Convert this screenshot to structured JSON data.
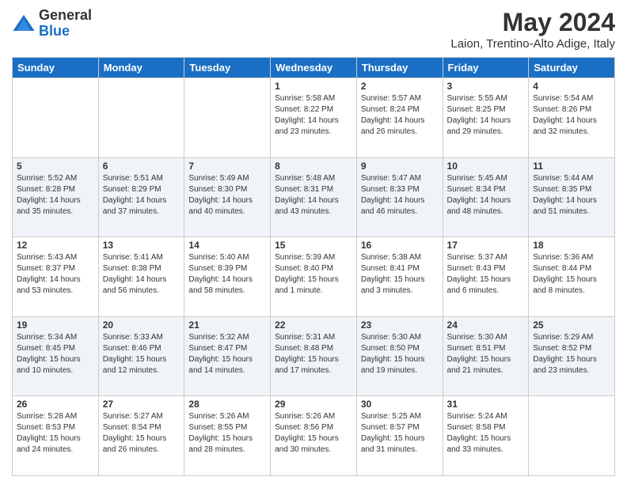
{
  "logo": {
    "general": "General",
    "blue": "Blue"
  },
  "title": "May 2024",
  "subtitle": "Laion, Trentino-Alto Adige, Italy",
  "days_of_week": [
    "Sunday",
    "Monday",
    "Tuesday",
    "Wednesday",
    "Thursday",
    "Friday",
    "Saturday"
  ],
  "weeks": [
    [
      {
        "day": "",
        "info": ""
      },
      {
        "day": "",
        "info": ""
      },
      {
        "day": "",
        "info": ""
      },
      {
        "day": "1",
        "info": "Sunrise: 5:58 AM\nSunset: 8:22 PM\nDaylight: 14 hours\nand 23 minutes."
      },
      {
        "day": "2",
        "info": "Sunrise: 5:57 AM\nSunset: 8:24 PM\nDaylight: 14 hours\nand 26 minutes."
      },
      {
        "day": "3",
        "info": "Sunrise: 5:55 AM\nSunset: 8:25 PM\nDaylight: 14 hours\nand 29 minutes."
      },
      {
        "day": "4",
        "info": "Sunrise: 5:54 AM\nSunset: 8:26 PM\nDaylight: 14 hours\nand 32 minutes."
      }
    ],
    [
      {
        "day": "5",
        "info": "Sunrise: 5:52 AM\nSunset: 8:28 PM\nDaylight: 14 hours\nand 35 minutes."
      },
      {
        "day": "6",
        "info": "Sunrise: 5:51 AM\nSunset: 8:29 PM\nDaylight: 14 hours\nand 37 minutes."
      },
      {
        "day": "7",
        "info": "Sunrise: 5:49 AM\nSunset: 8:30 PM\nDaylight: 14 hours\nand 40 minutes."
      },
      {
        "day": "8",
        "info": "Sunrise: 5:48 AM\nSunset: 8:31 PM\nDaylight: 14 hours\nand 43 minutes."
      },
      {
        "day": "9",
        "info": "Sunrise: 5:47 AM\nSunset: 8:33 PM\nDaylight: 14 hours\nand 46 minutes."
      },
      {
        "day": "10",
        "info": "Sunrise: 5:45 AM\nSunset: 8:34 PM\nDaylight: 14 hours\nand 48 minutes."
      },
      {
        "day": "11",
        "info": "Sunrise: 5:44 AM\nSunset: 8:35 PM\nDaylight: 14 hours\nand 51 minutes."
      }
    ],
    [
      {
        "day": "12",
        "info": "Sunrise: 5:43 AM\nSunset: 8:37 PM\nDaylight: 14 hours\nand 53 minutes."
      },
      {
        "day": "13",
        "info": "Sunrise: 5:41 AM\nSunset: 8:38 PM\nDaylight: 14 hours\nand 56 minutes."
      },
      {
        "day": "14",
        "info": "Sunrise: 5:40 AM\nSunset: 8:39 PM\nDaylight: 14 hours\nand 58 minutes."
      },
      {
        "day": "15",
        "info": "Sunrise: 5:39 AM\nSunset: 8:40 PM\nDaylight: 15 hours\nand 1 minute."
      },
      {
        "day": "16",
        "info": "Sunrise: 5:38 AM\nSunset: 8:41 PM\nDaylight: 15 hours\nand 3 minutes."
      },
      {
        "day": "17",
        "info": "Sunrise: 5:37 AM\nSunset: 8:43 PM\nDaylight: 15 hours\nand 6 minutes."
      },
      {
        "day": "18",
        "info": "Sunrise: 5:36 AM\nSunset: 8:44 PM\nDaylight: 15 hours\nand 8 minutes."
      }
    ],
    [
      {
        "day": "19",
        "info": "Sunrise: 5:34 AM\nSunset: 8:45 PM\nDaylight: 15 hours\nand 10 minutes."
      },
      {
        "day": "20",
        "info": "Sunrise: 5:33 AM\nSunset: 8:46 PM\nDaylight: 15 hours\nand 12 minutes."
      },
      {
        "day": "21",
        "info": "Sunrise: 5:32 AM\nSunset: 8:47 PM\nDaylight: 15 hours\nand 14 minutes."
      },
      {
        "day": "22",
        "info": "Sunrise: 5:31 AM\nSunset: 8:48 PM\nDaylight: 15 hours\nand 17 minutes."
      },
      {
        "day": "23",
        "info": "Sunrise: 5:30 AM\nSunset: 8:50 PM\nDaylight: 15 hours\nand 19 minutes."
      },
      {
        "day": "24",
        "info": "Sunrise: 5:30 AM\nSunset: 8:51 PM\nDaylight: 15 hours\nand 21 minutes."
      },
      {
        "day": "25",
        "info": "Sunrise: 5:29 AM\nSunset: 8:52 PM\nDaylight: 15 hours\nand 23 minutes."
      }
    ],
    [
      {
        "day": "26",
        "info": "Sunrise: 5:28 AM\nSunset: 8:53 PM\nDaylight: 15 hours\nand 24 minutes."
      },
      {
        "day": "27",
        "info": "Sunrise: 5:27 AM\nSunset: 8:54 PM\nDaylight: 15 hours\nand 26 minutes."
      },
      {
        "day": "28",
        "info": "Sunrise: 5:26 AM\nSunset: 8:55 PM\nDaylight: 15 hours\nand 28 minutes."
      },
      {
        "day": "29",
        "info": "Sunrise: 5:26 AM\nSunset: 8:56 PM\nDaylight: 15 hours\nand 30 minutes."
      },
      {
        "day": "30",
        "info": "Sunrise: 5:25 AM\nSunset: 8:57 PM\nDaylight: 15 hours\nand 31 minutes."
      },
      {
        "day": "31",
        "info": "Sunrise: 5:24 AM\nSunset: 8:58 PM\nDaylight: 15 hours\nand 33 minutes."
      },
      {
        "day": "",
        "info": ""
      }
    ]
  ]
}
